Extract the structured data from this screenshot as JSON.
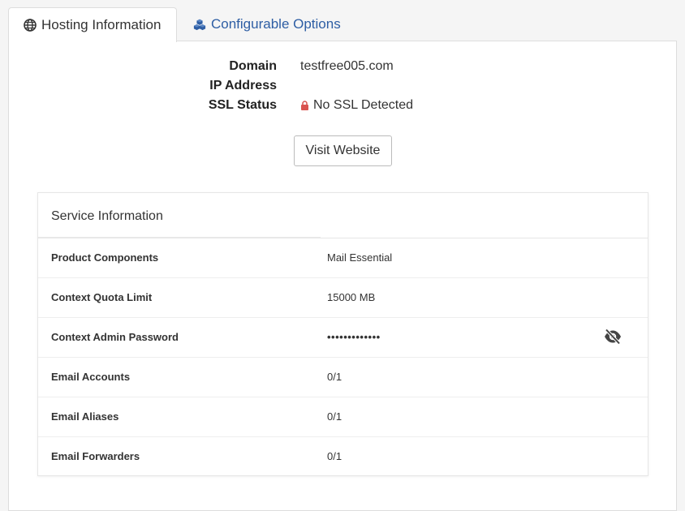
{
  "tabs": [
    {
      "label": "Hosting Information",
      "icon": "globe-icon",
      "active": true
    },
    {
      "label": "Configurable Options",
      "icon": "cubes-icon",
      "active": false
    }
  ],
  "hosting": {
    "domain_label": "Domain",
    "domain_value": "testfree005.com",
    "ip_label": "IP Address",
    "ip_value": "",
    "ssl_label": "SSL Status",
    "ssl_value": "No SSL Detected",
    "ssl_icon": "lock-icon",
    "visit_button": "Visit Website"
  },
  "service": {
    "title": "Service Information",
    "rows": [
      {
        "label": "Product Components",
        "value": "Mail Essential"
      },
      {
        "label": "Context Quota Limit",
        "value": "15000 MB"
      },
      {
        "label": "Context Admin Password",
        "value": "•••••••••••••"
      },
      {
        "label": "Email Accounts",
        "value": "0/1"
      },
      {
        "label": "Email Aliases",
        "value": "0/1"
      },
      {
        "label": "Email Forwarders",
        "value": "0/1"
      }
    ],
    "password_toggle_icon": "eye-slash-icon"
  },
  "colors": {
    "link": "#2e5ea4",
    "lock": "#d9534f",
    "border": "#dddddd"
  }
}
